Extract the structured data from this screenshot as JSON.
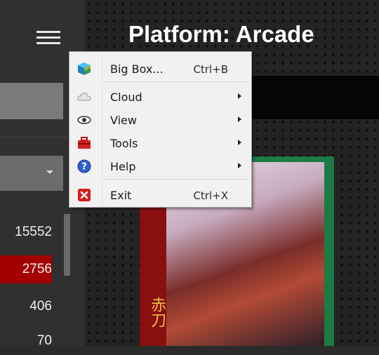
{
  "header": {
    "title": "Platform: Arcade"
  },
  "sidebar": {
    "counts": [
      {
        "value": "15552",
        "selected": false
      },
      {
        "value": "2756",
        "selected": true
      },
      {
        "value": "406",
        "selected": false
      },
      {
        "value": "70",
        "selected": false
      }
    ]
  },
  "cover": {
    "spine_text": "赤刀"
  },
  "menu": {
    "items": [
      {
        "label": "Big Box...",
        "shortcut": "Ctrl+B",
        "icon": "bigbox-cube-icon",
        "submenu": false
      },
      {
        "label": "Cloud",
        "shortcut": "",
        "icon": "cloud-icon",
        "submenu": true
      },
      {
        "label": "View",
        "shortcut": "",
        "icon": "eye-icon",
        "submenu": true
      },
      {
        "label": "Tools",
        "shortcut": "",
        "icon": "toolbox-icon",
        "submenu": true
      },
      {
        "label": "Help",
        "shortcut": "",
        "icon": "help-icon",
        "submenu": true
      },
      {
        "label": "Exit",
        "shortcut": "Ctrl+X",
        "icon": "exit-icon",
        "submenu": false
      }
    ]
  },
  "colors": {
    "selected_row": "#a30000",
    "menu_background": "#f1f1f1",
    "sidebar": "#303030"
  }
}
